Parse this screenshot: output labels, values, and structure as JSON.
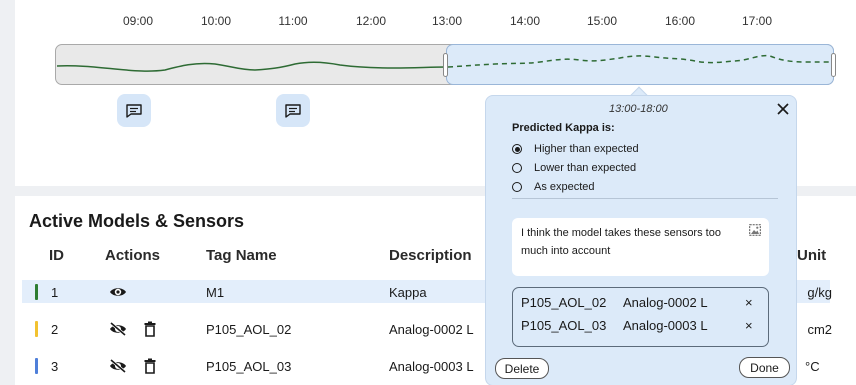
{
  "timeline": {
    "hours": [
      "09:00",
      "10:00",
      "11:00",
      "12:00",
      "13:00",
      "14:00",
      "15:00",
      "16:00",
      "17:00"
    ],
    "selected_range": "13:00-18:00",
    "comment_markers": [
      "comment-icon",
      "comment-icon"
    ]
  },
  "models": {
    "title": "Active Models & Sensors",
    "columns": {
      "id": "ID",
      "actions": "Actions",
      "tag": "Tag Name",
      "description": "Description",
      "unit": "Unit"
    },
    "rows": [
      {
        "id": "1",
        "actions": [
          "eye-icon"
        ],
        "tag": "M1",
        "description": "Kappa",
        "unit": "g/kg",
        "color": "#2e7d32",
        "highlighted": true
      },
      {
        "id": "2",
        "actions": [
          "eye-off-icon",
          "trash-icon"
        ],
        "tag": "P105_AOL_02",
        "description": "Analog-0002 L",
        "unit": "cm2",
        "color": "#f2c230",
        "highlighted": false
      },
      {
        "id": "3",
        "actions": [
          "eye-off-icon",
          "trash-icon"
        ],
        "tag": "P105_AOL_03",
        "description": "Analog-0003 L",
        "unit": "°C",
        "color": "#4f7fd9",
        "highlighted": false
      }
    ]
  },
  "popover": {
    "range": "13:00-18:00",
    "question": "Predicted Kappa is:",
    "options": [
      {
        "label": "Higher than expected",
        "selected": true
      },
      {
        "label": "Lower than expected",
        "selected": false
      },
      {
        "label": "As expected",
        "selected": false
      }
    ],
    "comment": "I think the model takes these sensors too much into account",
    "sensors": [
      {
        "tag": "P105_AOL_02",
        "desc": "Analog-0002 L",
        "remove": "×"
      },
      {
        "tag": "P105_AOL_03",
        "desc": "Analog-0003 L",
        "remove": "×"
      }
    ],
    "delete_label": "Delete",
    "done_label": "Done"
  },
  "colors": {
    "accent": "#dceaf9",
    "trend": "#2e6b34",
    "highlight_row": "#e3eefb"
  }
}
